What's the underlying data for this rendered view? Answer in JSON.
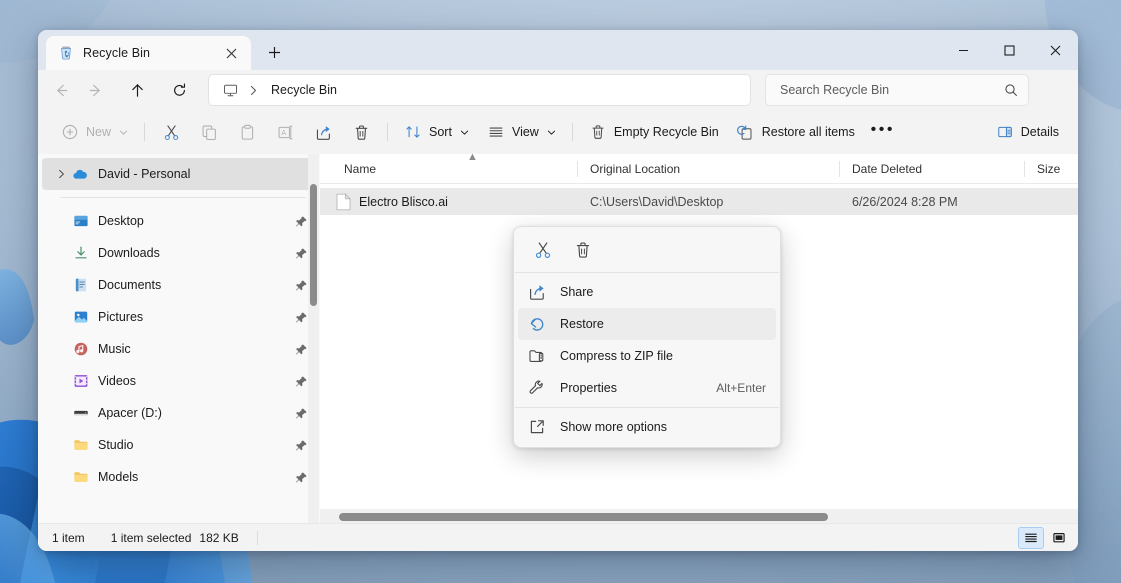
{
  "window": {
    "title": "Recycle Bin",
    "tab_icon": "recycle-bin-icon",
    "close_tab_label": "✕",
    "new_tab_label": "+",
    "minimize_label": "—",
    "maximize_label": "□",
    "close_label": "✕"
  },
  "nav": {
    "back": "back-arrow",
    "forward": "forward-arrow",
    "up": "up-arrow",
    "refresh": "refresh",
    "breadcrumb_icon": "this-pc-monitor-icon",
    "breadcrumb_separator": "›",
    "breadcrumb_text": "Recycle Bin"
  },
  "search": {
    "placeholder": "Search Recycle Bin",
    "value": "",
    "icon": "search-icon"
  },
  "toolbar": {
    "new_label": "New",
    "cut_label": "Cut",
    "copy_label": "Copy",
    "paste_label": "Paste",
    "rename_label": "Rename",
    "share_label": "Share",
    "delete_label": "Delete",
    "sort_label": "Sort",
    "view_label": "View",
    "empty_recycle_bin_label": "Empty Recycle Bin",
    "restore_all_items_label": "Restore all items",
    "more_label": "•••",
    "details_label": "Details"
  },
  "sidebar": {
    "cloud": {
      "label": "David - Personal",
      "icon": "onedrive-cloud-icon",
      "expander": "›",
      "active": true
    },
    "items": [
      {
        "label": "Desktop",
        "icon": "desktop-icon",
        "pinned": true
      },
      {
        "label": "Downloads",
        "icon": "downloads-icon",
        "pinned": true
      },
      {
        "label": "Documents",
        "icon": "documents-icon",
        "pinned": true
      },
      {
        "label": "Pictures",
        "icon": "pictures-icon",
        "pinned": true
      },
      {
        "label": "Music",
        "icon": "music-icon",
        "pinned": true
      },
      {
        "label": "Videos",
        "icon": "videos-icon",
        "pinned": true
      },
      {
        "label": "Apacer (D:)",
        "icon": "drive-icon",
        "pinned": true
      },
      {
        "label": "Studio",
        "icon": "folder-icon",
        "pinned": true
      },
      {
        "label": "Models",
        "icon": "folder-icon",
        "pinned": true
      }
    ]
  },
  "filelist": {
    "sort_indicator": "▲",
    "columns": [
      {
        "label": "Name"
      },
      {
        "label": "Original Location"
      },
      {
        "label": "Date Deleted"
      },
      {
        "label": "Size"
      }
    ],
    "rows": [
      {
        "name": "Electro Blisco.ai",
        "icon": "generic-file-icon",
        "original_location": "C:\\Users\\David\\Desktop",
        "date_deleted": "6/26/2024 8:28 PM",
        "size": "",
        "selected": true
      }
    ]
  },
  "context_menu": {
    "icon_row": [
      {
        "name": "cut-icon",
        "label": "Cut"
      },
      {
        "name": "delete-icon",
        "label": "Delete"
      }
    ],
    "items": [
      {
        "label": "Share",
        "icon": "share-icon",
        "accel": "",
        "highlighted": false
      },
      {
        "label": "Restore",
        "icon": "restore-icon",
        "accel": "",
        "highlighted": true
      },
      {
        "label": "Compress to ZIP file",
        "icon": "zip-icon",
        "accel": "",
        "highlighted": false
      },
      {
        "label": "Properties",
        "icon": "wrench-icon",
        "accel": "Alt+Enter",
        "highlighted": false
      },
      {
        "label": "Show more options",
        "icon": "more-options-icon",
        "accel": "",
        "highlighted": false
      }
    ]
  },
  "statusbar": {
    "item_count": "1 item",
    "selection": "1 item selected",
    "selection_size": "182 KB",
    "view_details_icon": "details-view-icon",
    "view_large_icons_icon": "large-icons-view-icon"
  },
  "colors": {
    "accent": "#0067c0",
    "window_bg": "#f3f3f3",
    "sidebar_bg": "#f9f9f9",
    "selection_bg": "#e9e9e9",
    "menu_bg": "#f7f7f7",
    "desktop": "#a8bed4"
  }
}
